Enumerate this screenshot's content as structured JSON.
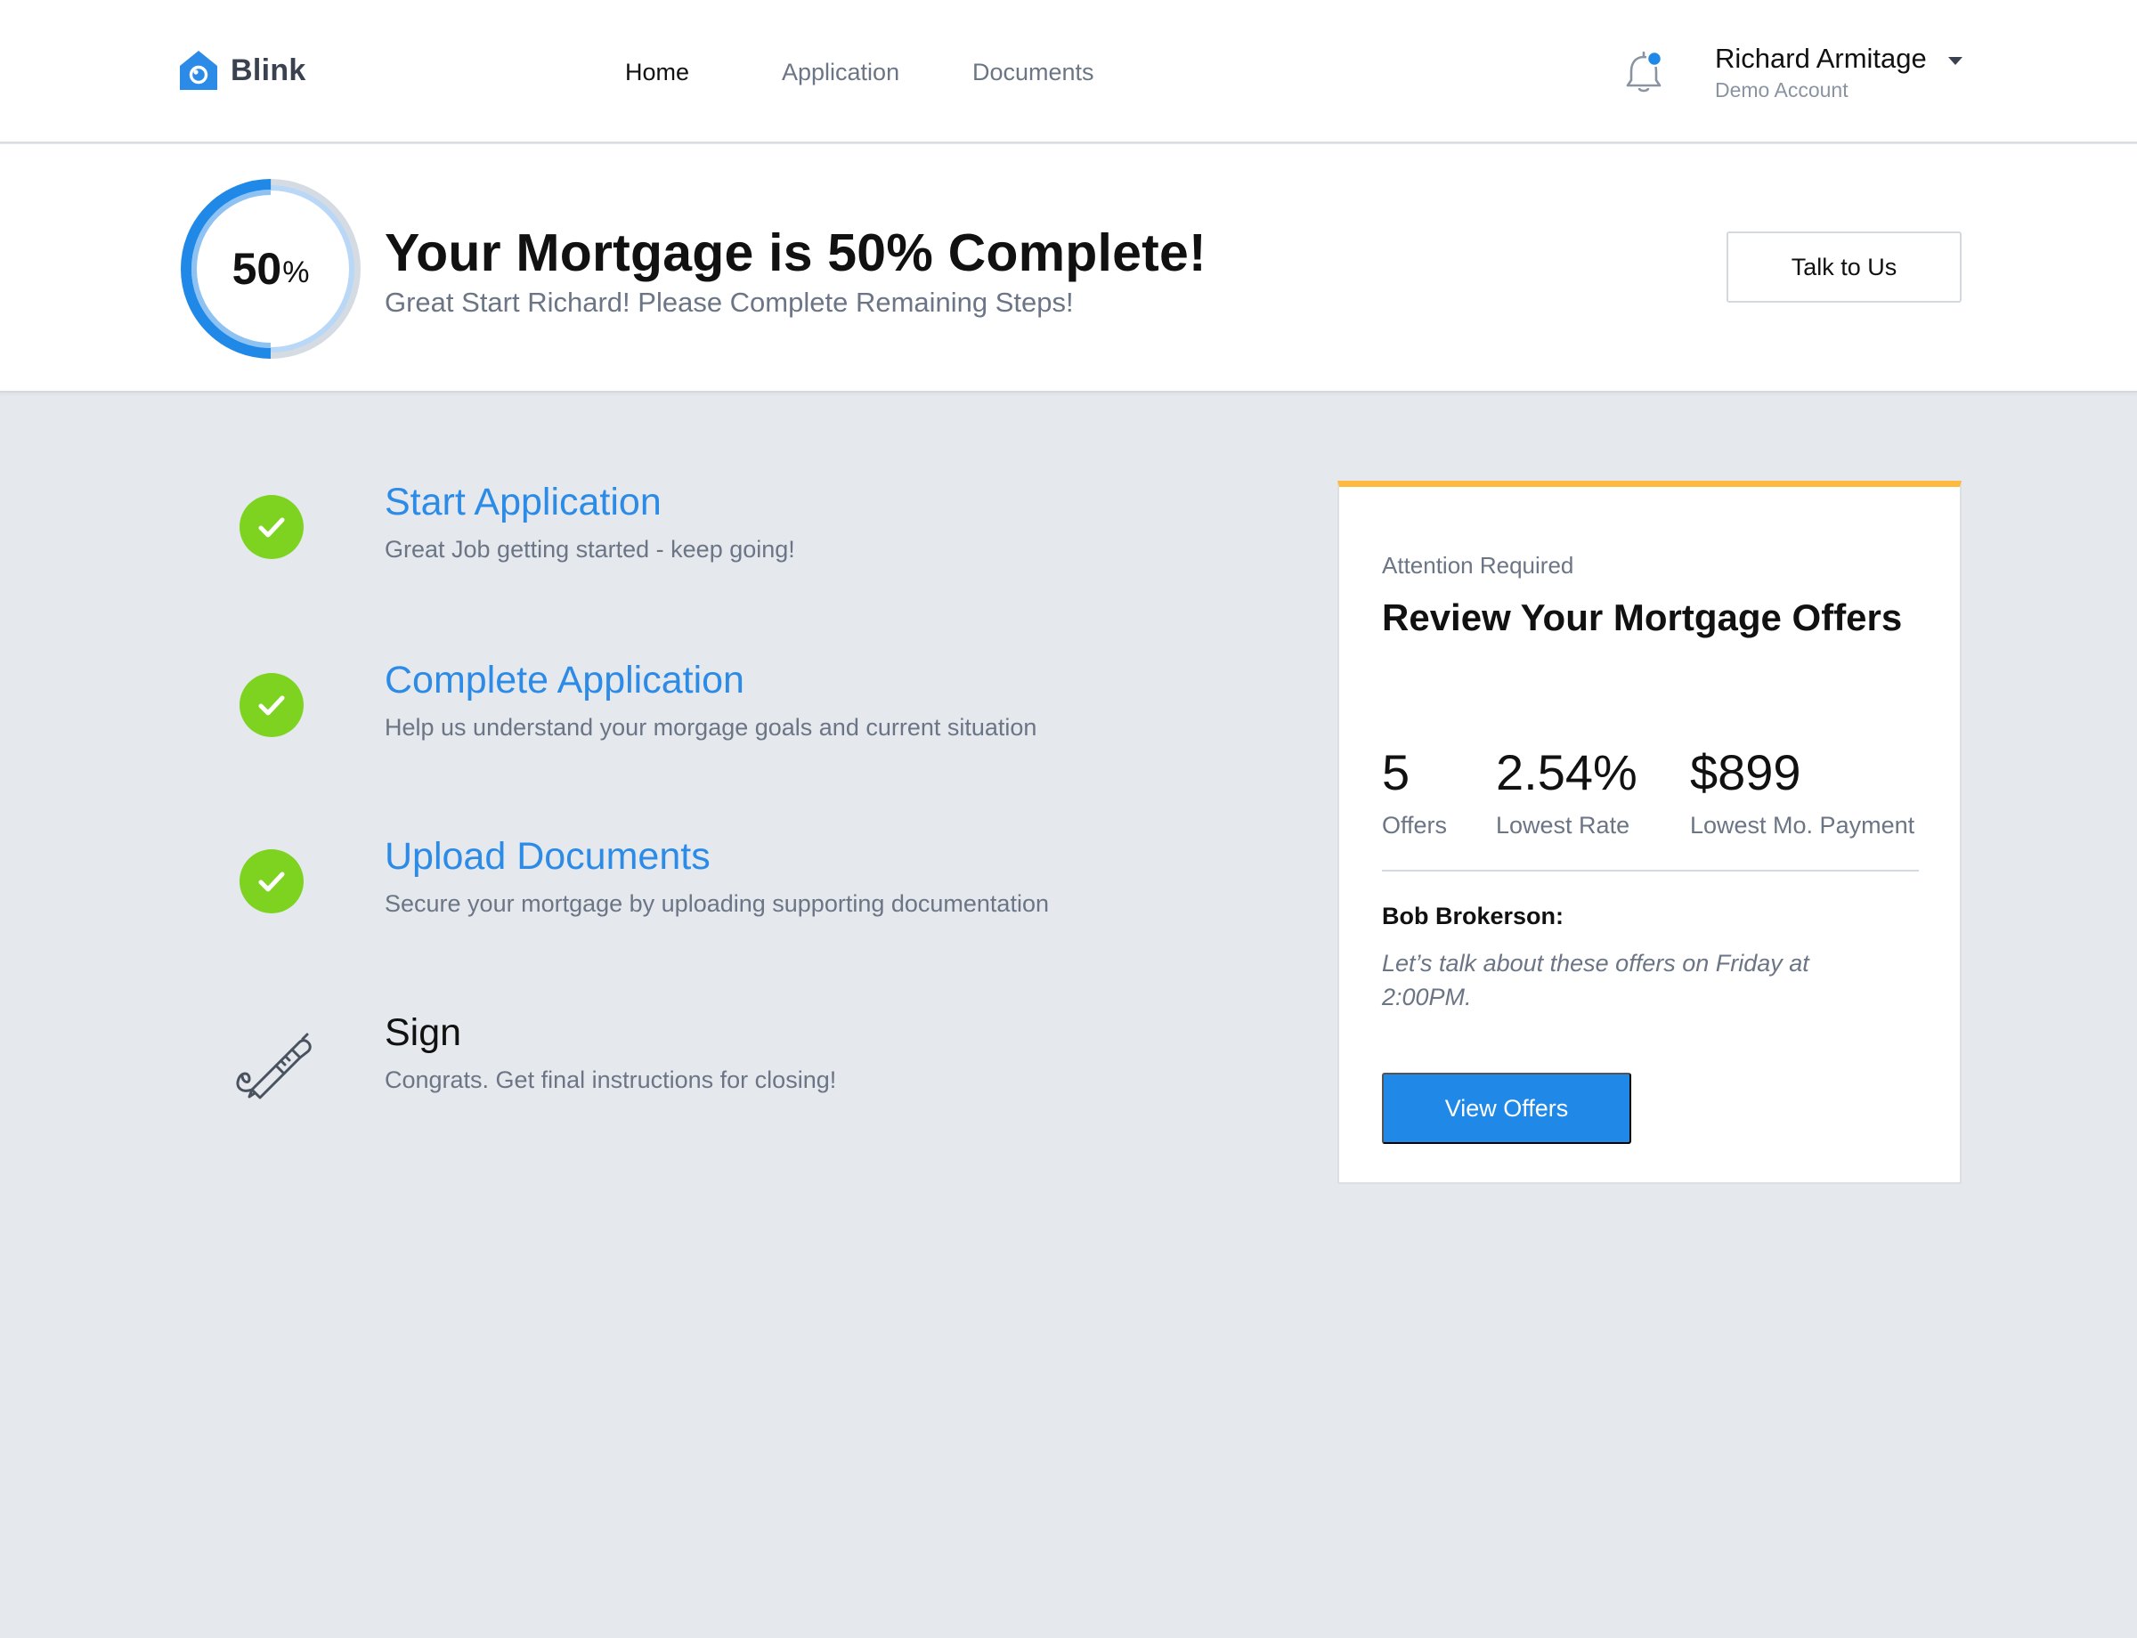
{
  "brand": {
    "name": "Blink",
    "logo_icon": "house-icon",
    "color": "#2089E8"
  },
  "nav": {
    "items": [
      {
        "label": "Home",
        "active": true
      },
      {
        "label": "Application",
        "active": false
      },
      {
        "label": "Documents",
        "active": false
      }
    ]
  },
  "notifications": {
    "icon": "bell-icon",
    "has_unread": true
  },
  "user": {
    "name": "Richard Armitage",
    "subtitle": "Demo Account"
  },
  "progress": {
    "percent_value": "50",
    "percent_sign": "%",
    "fraction": 0.5,
    "title": "Your Mortgage is 50% Complete!",
    "subtitle": "Great Start Richard! Please Complete Remaining Steps!",
    "talk_button": "Talk to Us"
  },
  "steps": [
    {
      "title": "Start Application",
      "desc": "Great Job getting started - keep going!",
      "status": "complete",
      "icon": "check-icon"
    },
    {
      "title": "Complete Application",
      "desc": "Help us understand your morgage goals and current situation",
      "status": "complete",
      "icon": "check-icon"
    },
    {
      "title": "Upload Documents",
      "desc": "Secure your mortgage by uploading supporting documentation",
      "status": "complete",
      "icon": "check-icon"
    },
    {
      "title": "Sign",
      "desc": "Congrats. Get final instructions for closing!",
      "status": "pending",
      "icon": "pen-icon"
    }
  ],
  "offers": {
    "eyebrow": "Attention Required",
    "title": "Review Your Mortgage Offers",
    "stats": [
      {
        "value": "5",
        "label": "Offers"
      },
      {
        "value": "2.54%",
        "label": "Lowest Rate"
      },
      {
        "value": "$899",
        "label": "Lowest Mo. Payment"
      }
    ],
    "broker_name": "Bob Brokerson:",
    "broker_message": "Let’s talk about these offers on Friday at 2:00PM.",
    "button": "View Offers",
    "accent_color": "#FDB940"
  },
  "colors": {
    "link": "#2B8BE6",
    "success": "#7ED321",
    "background": "#E5E9ED"
  }
}
